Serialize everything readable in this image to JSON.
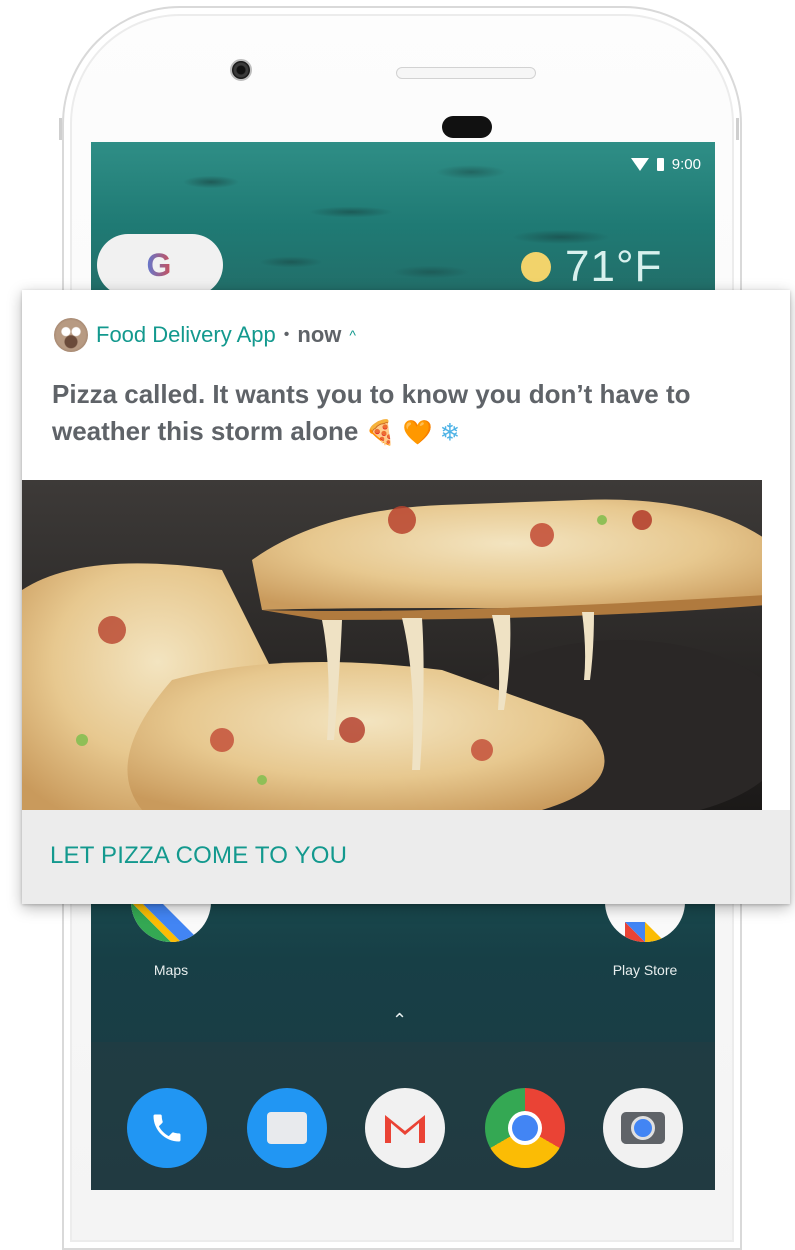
{
  "status_bar": {
    "time": "9:00"
  },
  "home": {
    "weather_temp": "71°F",
    "apps": [
      {
        "label": "Maps",
        "icon": "maps-icon"
      },
      {
        "label": "Play Store",
        "icon": "play-store-icon"
      }
    ],
    "dock": [
      "phone-icon",
      "messages-icon",
      "gmail-icon",
      "chrome-icon",
      "camera-icon"
    ],
    "google_icon": "G"
  },
  "notification": {
    "app_name": "Food Delivery App",
    "separator": "•",
    "time": "now",
    "expand_icon": "^",
    "message": "Pizza called. It wants you to know you don’t have to weather this storm alone",
    "emojis": [
      "🍕",
      "🧡",
      "❄"
    ],
    "action_label": "LET PIZZA COME TO YOU",
    "image_icon": "pizza-photo"
  },
  "colors": {
    "accent": "#13998e",
    "text": "#5f6368",
    "action_bg": "#ececec"
  }
}
